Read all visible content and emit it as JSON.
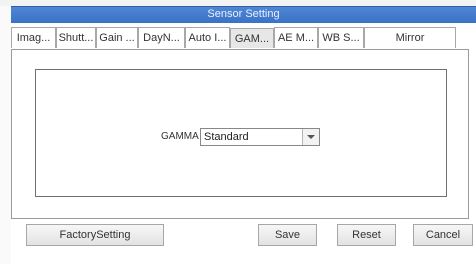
{
  "window": {
    "title": "Sensor Setting"
  },
  "tabs": [
    {
      "label": "Imag..."
    },
    {
      "label": "Shutt..."
    },
    {
      "label": "Gain ..."
    },
    {
      "label": "DayN..."
    },
    {
      "label": "Auto I..."
    },
    {
      "label": "GAM..."
    },
    {
      "label": "AE M..."
    },
    {
      "label": "WB S..."
    },
    {
      "label": "Mirror"
    }
  ],
  "active_tab": "GAM...",
  "gamma": {
    "label": "GAMMA",
    "selected": "Standard"
  },
  "buttons": {
    "factory": "FactorySetting",
    "save": "Save",
    "reset": "Reset",
    "cancel": "Cancel"
  }
}
